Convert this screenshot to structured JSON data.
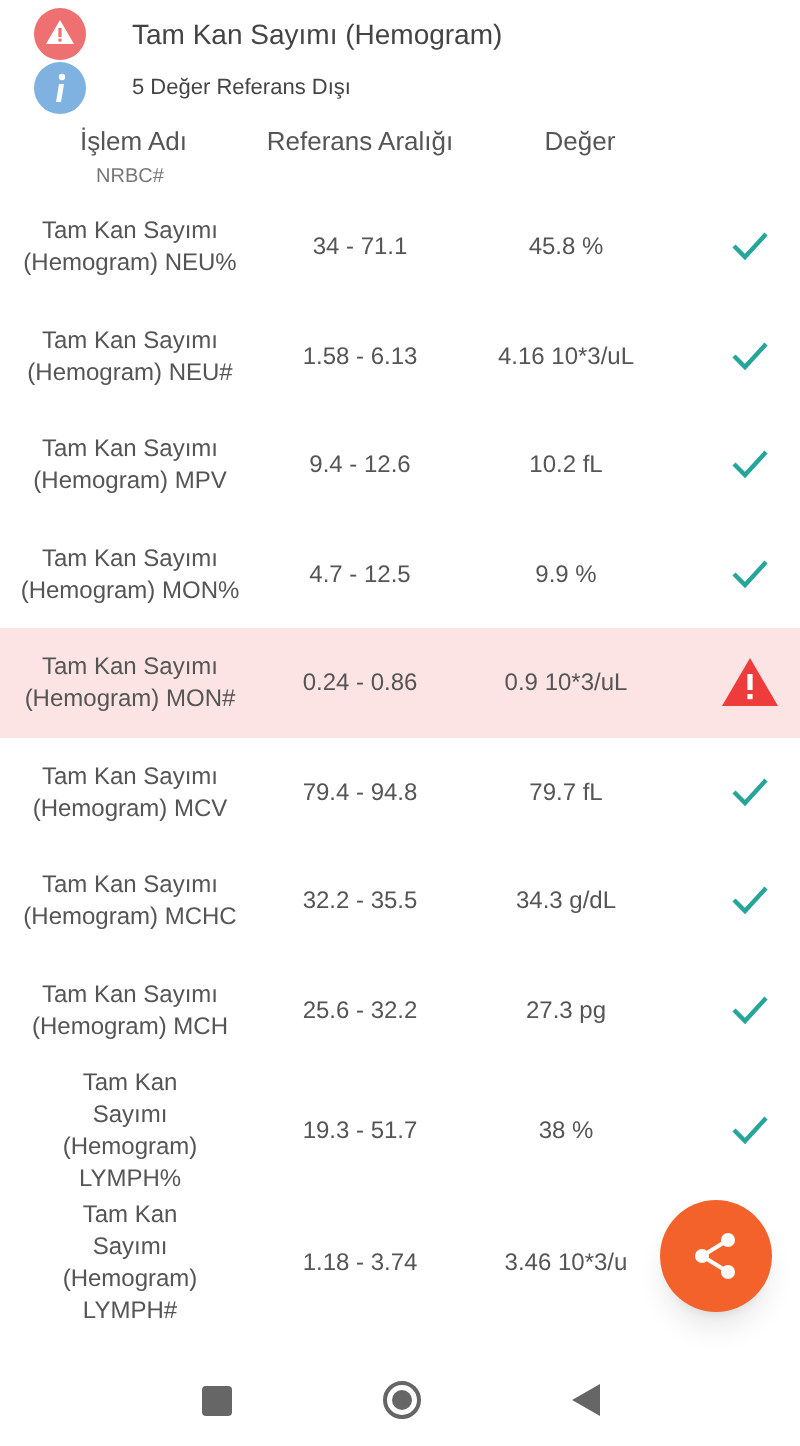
{
  "header": {
    "title": "Tam Kan Sayımı (Hemogram)",
    "subtitle": "5 Değer Referans Dışı"
  },
  "columns": [
    "İşlem Adı",
    "Referans Aralığı",
    "Değer"
  ],
  "partial_row": "NRBC#",
  "rows": [
    {
      "name": "Tam Kan Sayımı (Hemogram) NEU%",
      "range": "34 - 71.1",
      "value": "45.8 %",
      "out_of_range": false
    },
    {
      "name": "Tam Kan Sayımı (Hemogram) NEU#",
      "range": "1.58 - 6.13",
      "value": "4.16 10*3/uL",
      "out_of_range": false
    },
    {
      "name": "Tam Kan Sayımı (Hemogram) MPV",
      "range": "9.4 - 12.6",
      "value": "10.2 fL",
      "out_of_range": false
    },
    {
      "name": "Tam Kan Sayımı (Hemogram) MON%",
      "range": "4.7 - 12.5",
      "value": "9.9 %",
      "out_of_range": false
    },
    {
      "name": "Tam Kan Sayımı (Hemogram) MON#",
      "range": "0.24 - 0.86",
      "value": "0.9 10*3/uL",
      "out_of_range": true
    },
    {
      "name": "Tam Kan Sayımı (Hemogram) MCV",
      "range": "79.4 - 94.8",
      "value": "79.7 fL",
      "out_of_range": false
    },
    {
      "name": "Tam Kan Sayımı (Hemogram) MCHC",
      "range": "32.2 - 35.5",
      "value": "34.3 g/dL",
      "out_of_range": false
    },
    {
      "name": "Tam Kan Sayımı (Hemogram) MCH",
      "range": "25.6 - 32.2",
      "value": "27.3 pg",
      "out_of_range": false
    },
    {
      "name": "Tam Kan Sayımı (Hemogram) LYMPH%",
      "range": "19.3 - 51.7",
      "value": "38 %",
      "out_of_range": false
    },
    {
      "name": "Tam Kan Sayımı (Hemogram) LYMPH#",
      "range": "1.18 - 3.74",
      "value": "3.46 10*3/u",
      "out_of_range": null
    }
  ]
}
